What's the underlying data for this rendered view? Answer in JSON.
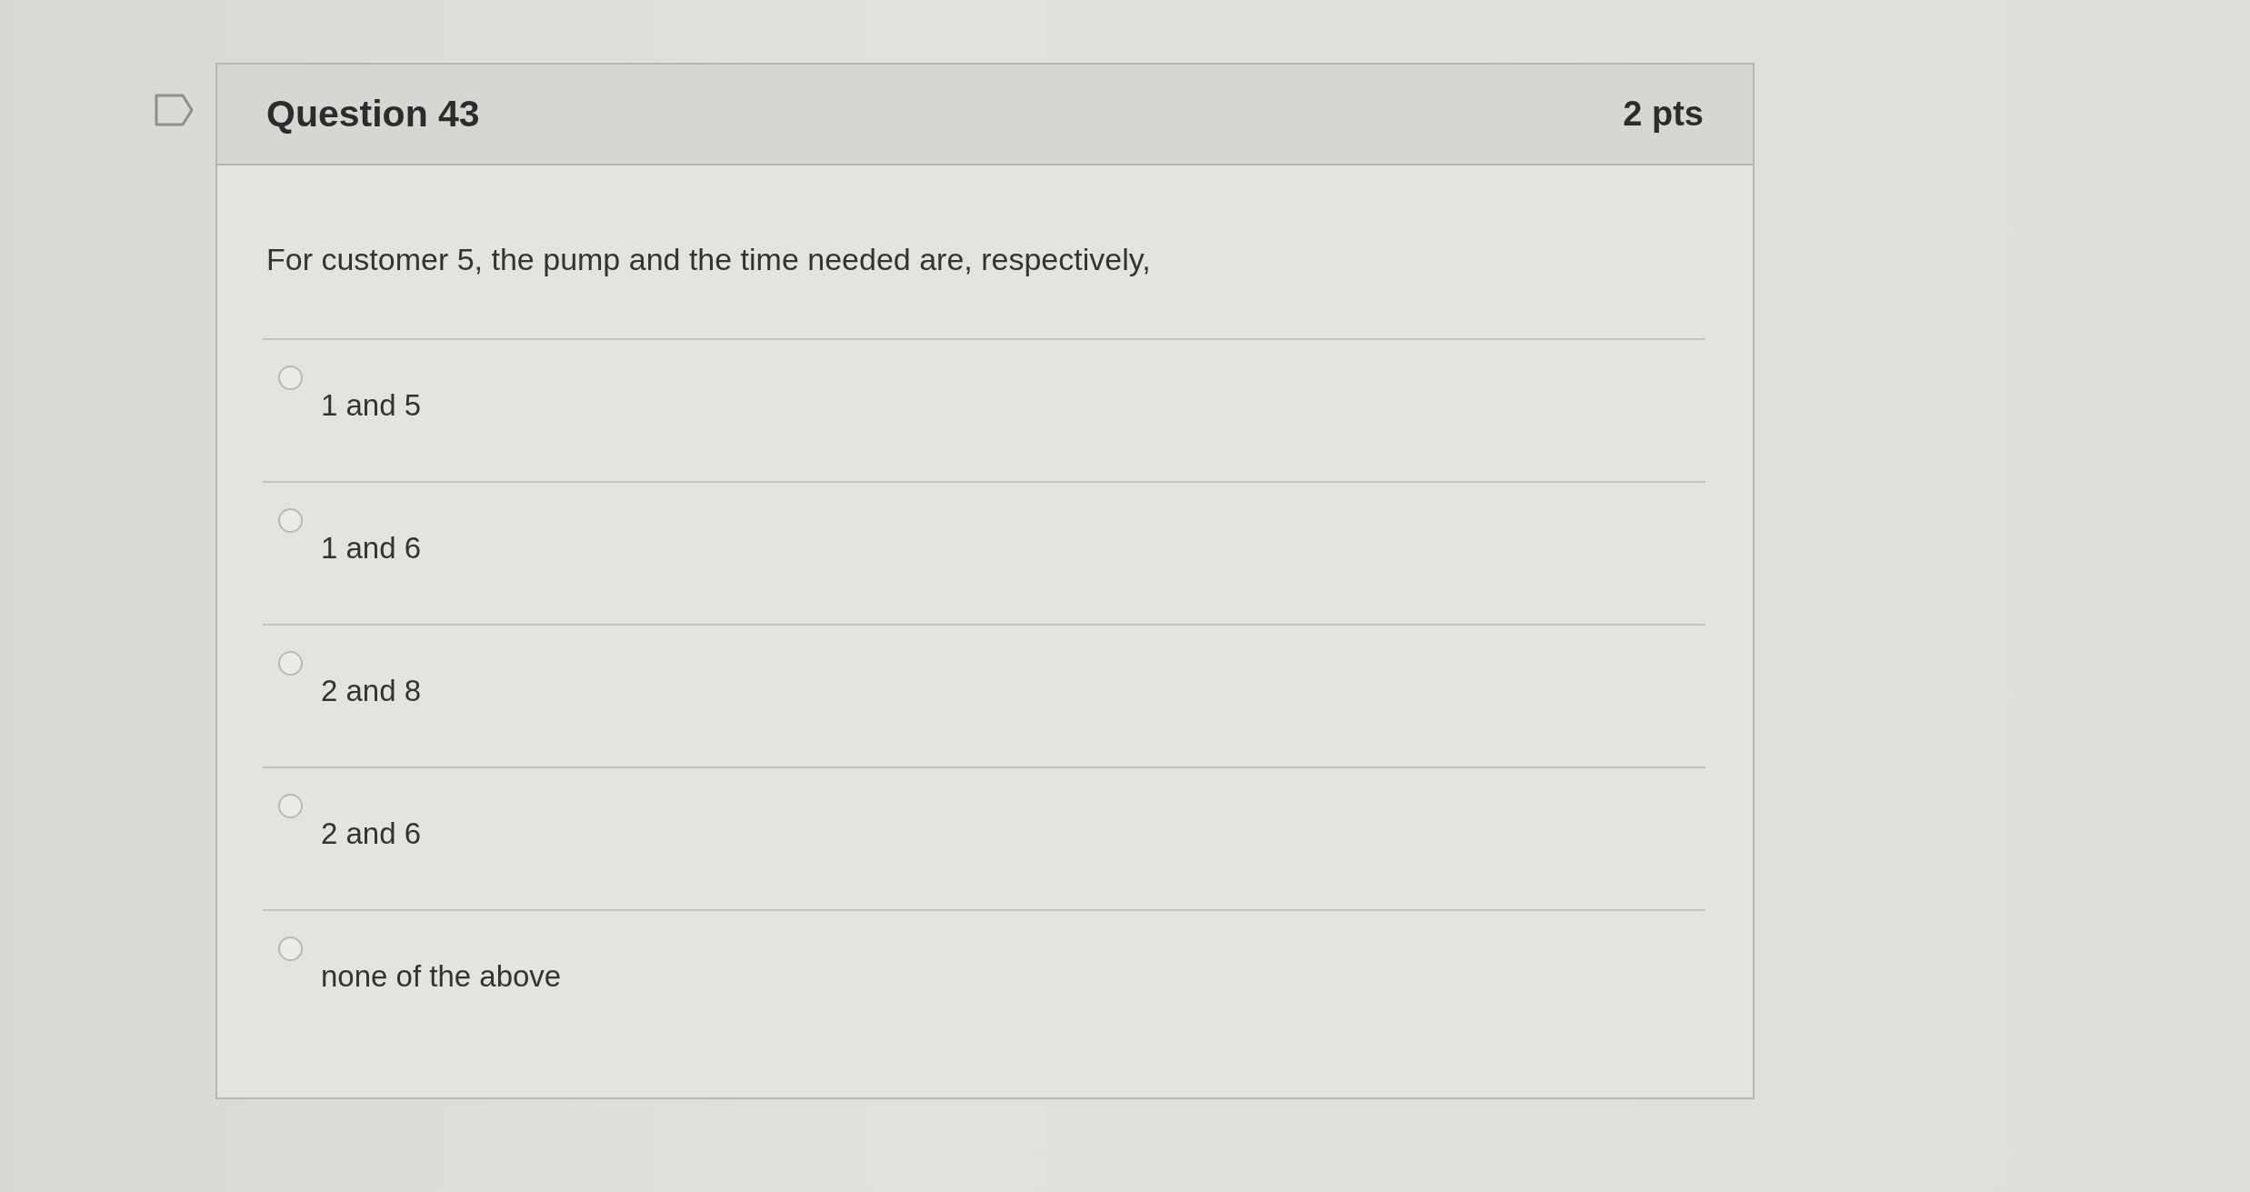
{
  "question": {
    "title": "Question 43",
    "points": "2 pts",
    "prompt": "For customer 5, the pump and the time needed are, respectively,"
  },
  "answers": [
    {
      "label": "1 and 5",
      "selected": false
    },
    {
      "label": "1 and 6",
      "selected": false
    },
    {
      "label": "2 and 8",
      "selected": false
    },
    {
      "label": "2 and 6",
      "selected": false
    },
    {
      "label": "none of the above",
      "selected": false
    }
  ]
}
